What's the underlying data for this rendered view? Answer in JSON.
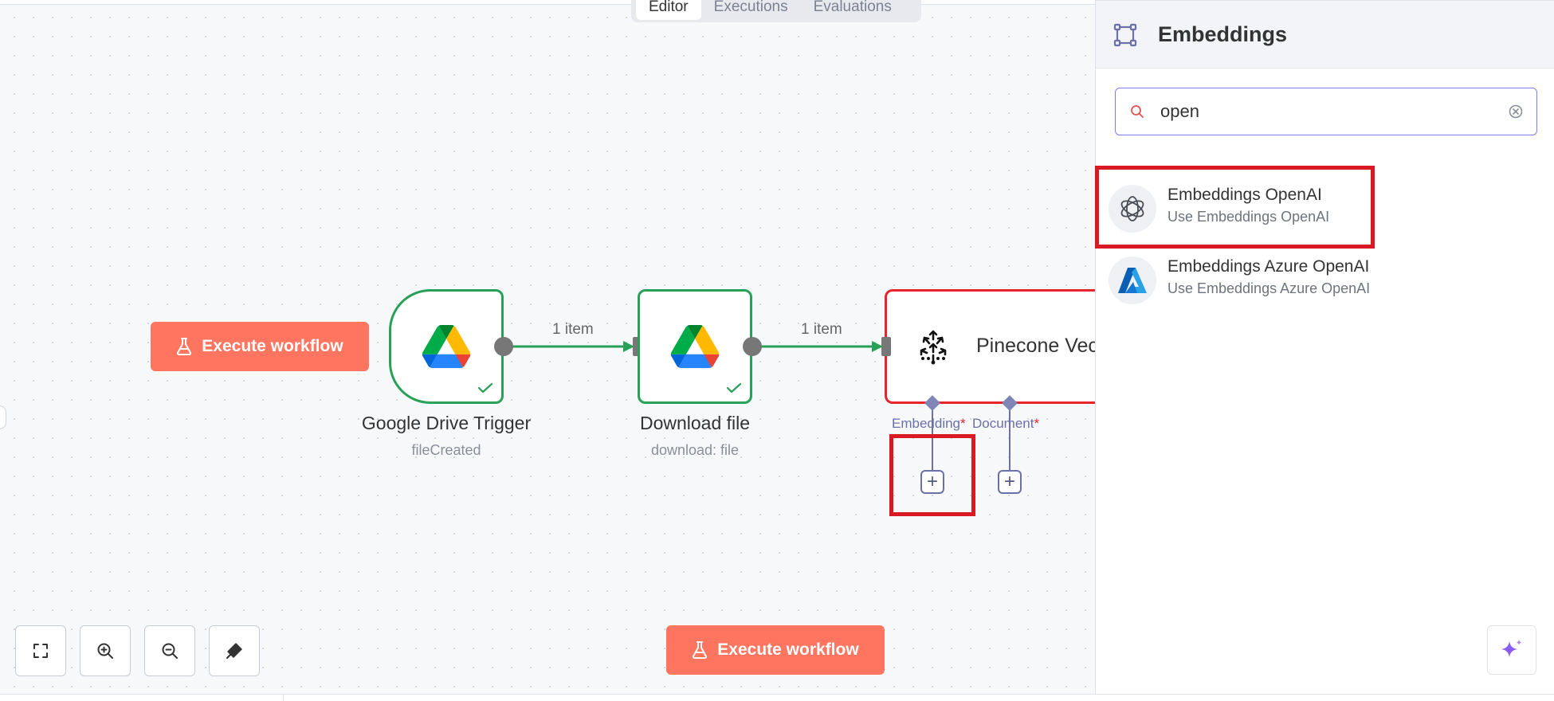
{
  "tabs": [
    {
      "label": "Editor",
      "active": true
    },
    {
      "label": "Executions",
      "active": false
    },
    {
      "label": "Evaluations",
      "active": false
    }
  ],
  "canvas": {
    "execute_workflow_label": "Execute workflow",
    "nodes": [
      {
        "title": "Google Drive Trigger",
        "subtitle": "fileCreated",
        "icon": "google-drive-icon",
        "status": "success"
      },
      {
        "title": "Download file",
        "subtitle": "download: file",
        "icon": "google-drive-icon",
        "status": "success"
      },
      {
        "title": "Pinecone Vec",
        "icon": "pinecone-icon"
      }
    ],
    "edges": [
      {
        "label": "1 item"
      },
      {
        "label": "1 item"
      }
    ],
    "ports": [
      {
        "label": "Embedding",
        "required": "*"
      },
      {
        "label": "Document",
        "required": "*"
      }
    ],
    "controls": [
      "fit-view-icon",
      "zoom-in-icon",
      "zoom-out-icon",
      "clean-up-icon"
    ]
  },
  "footer": {
    "execute_workflow_label": "Execute workflow"
  },
  "panel": {
    "title": "Embeddings",
    "search": {
      "value": "open",
      "placeholder": ""
    },
    "results": [
      {
        "title": "Embeddings OpenAI",
        "subtitle": "Use Embeddings OpenAI",
        "icon": "openai-icon"
      },
      {
        "title": "Embeddings Azure OpenAI",
        "subtitle": "Use Embeddings Azure OpenAI",
        "icon": "azure-icon"
      }
    ]
  },
  "colors": {
    "accent": "#ff7560",
    "success": "#29a058",
    "error": "#e5242c",
    "port": "#6b70a8",
    "highlight": "#d91a24"
  }
}
